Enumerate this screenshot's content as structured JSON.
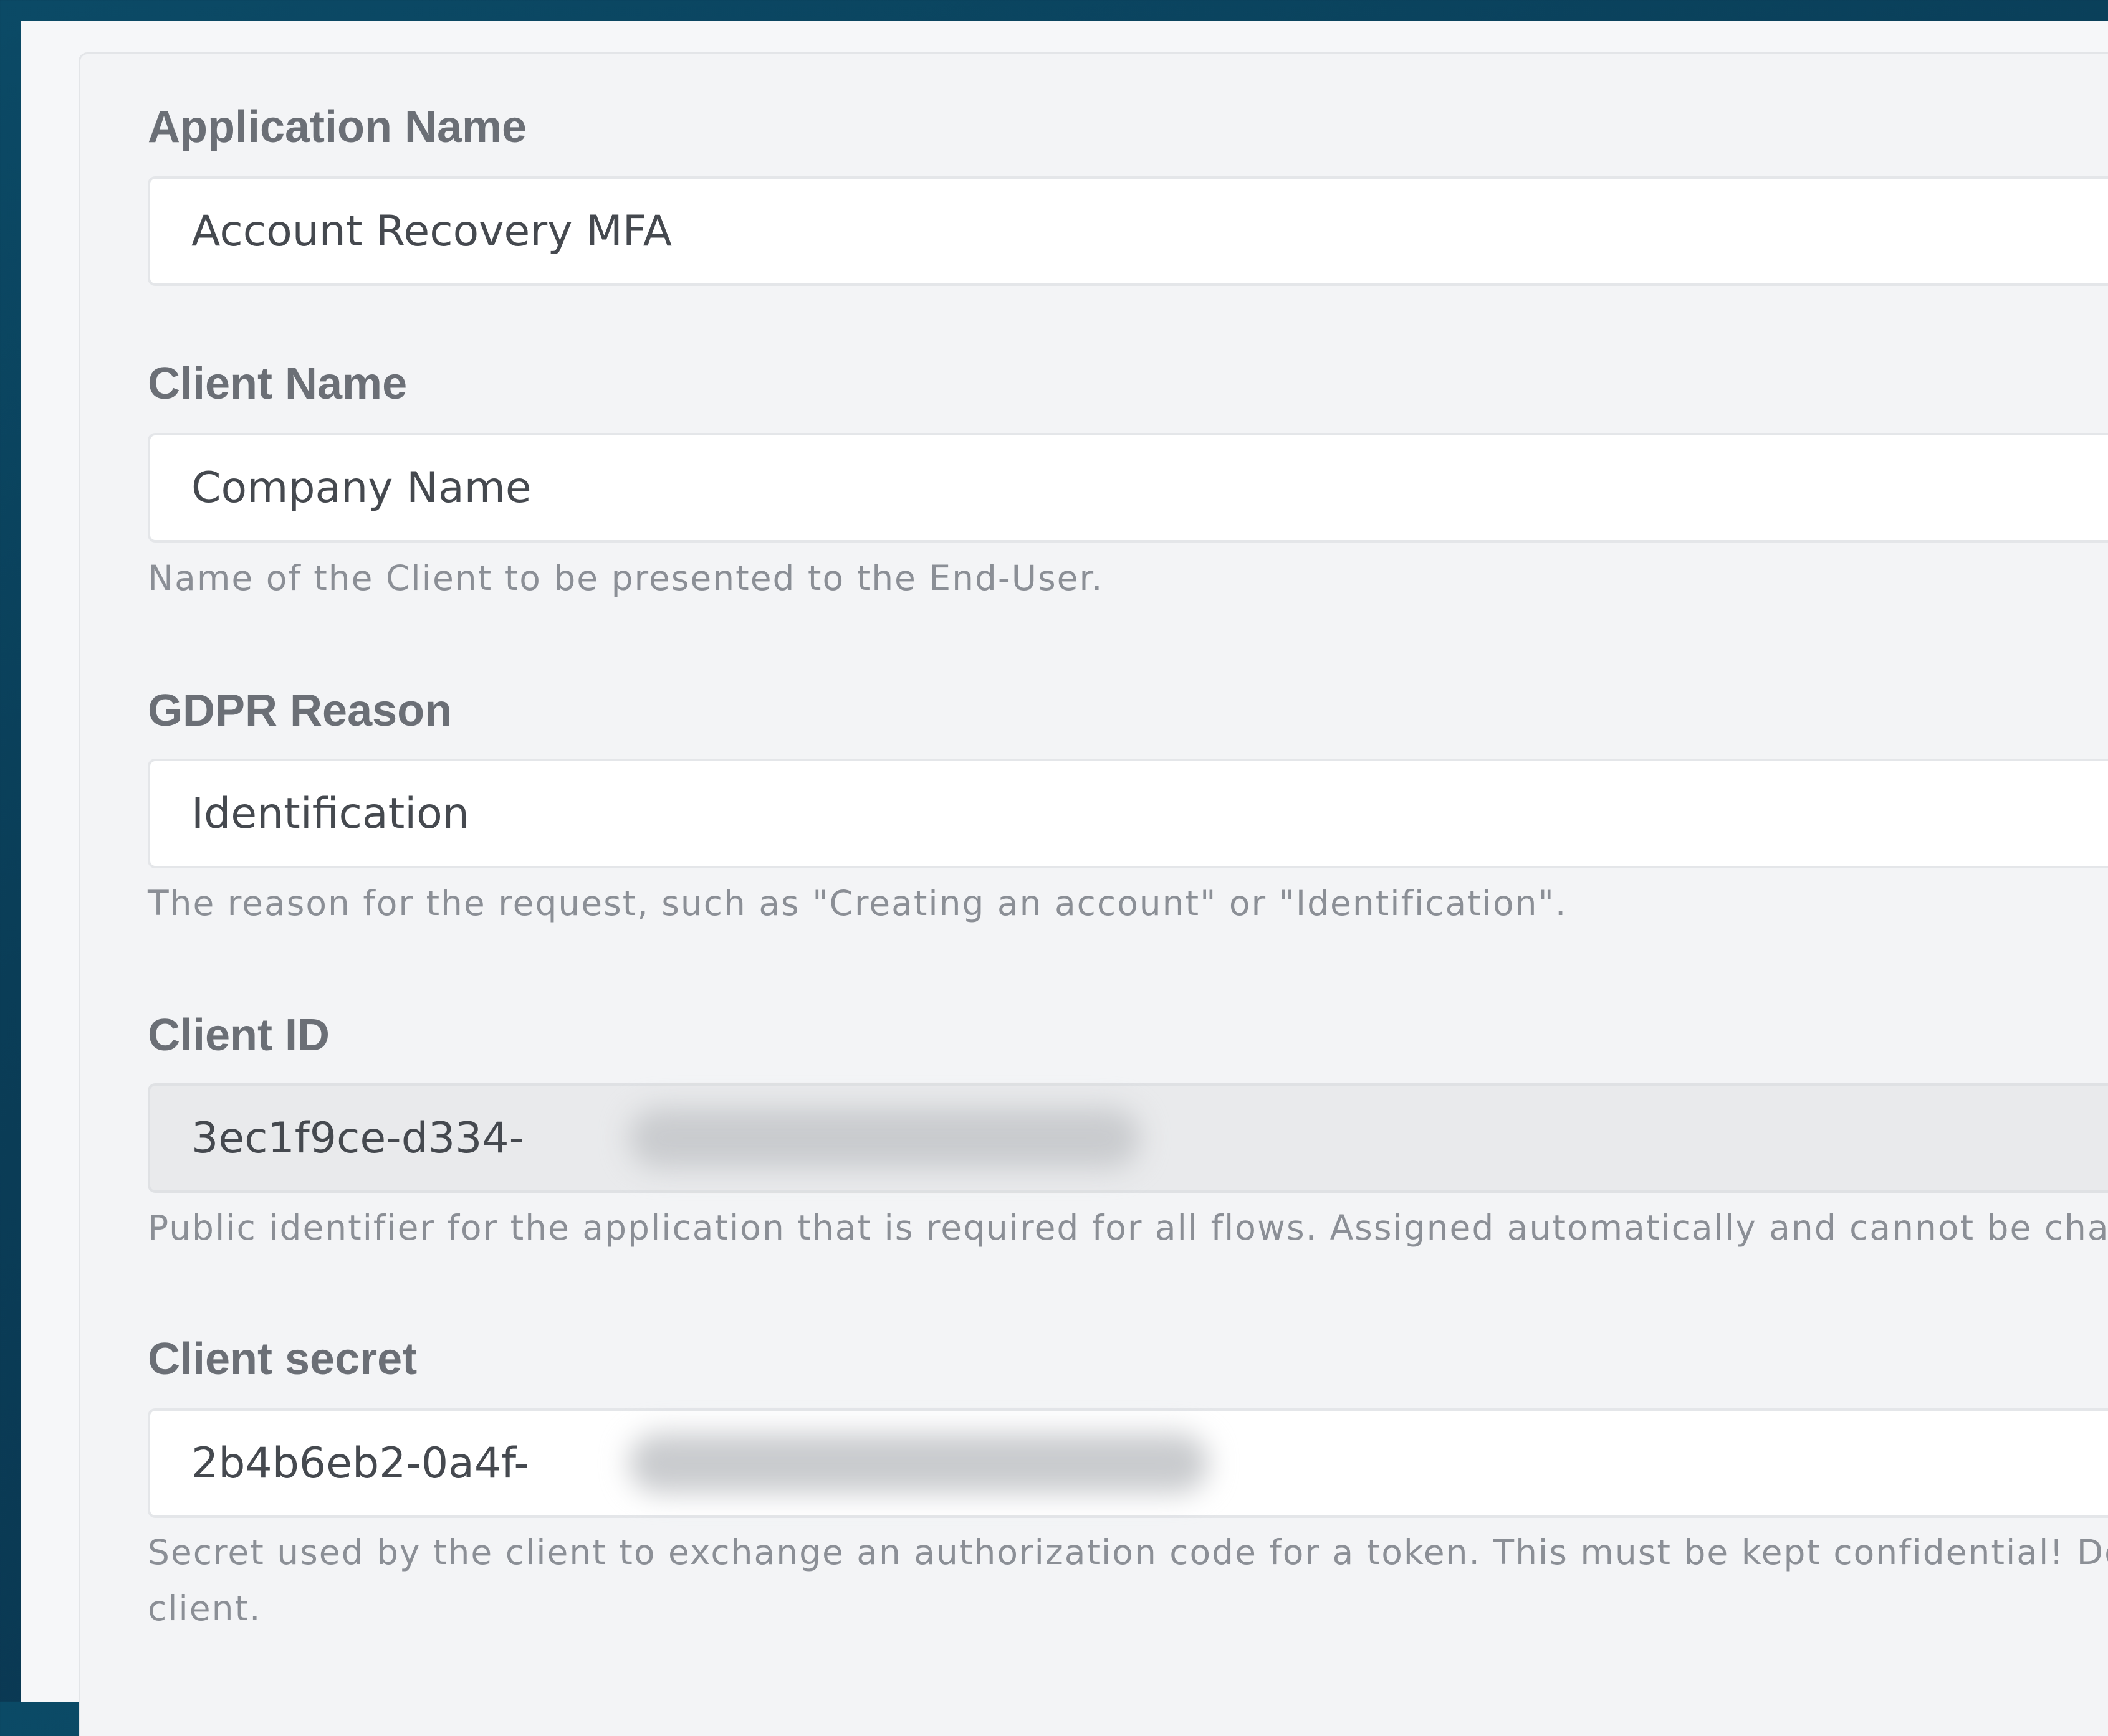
{
  "form": {
    "application_name": {
      "label": "Application Name",
      "value": "Account Recovery MFA"
    },
    "client_name": {
      "label": "Client Name",
      "value": "Company Name",
      "help": "Name of the Client to be presented to the End-User."
    },
    "gdpr_reason": {
      "label": "GDPR Reason",
      "value": "Identification",
      "help": "The reason for the request, such as \"Creating an account\" or \"Identification\"."
    },
    "client_id": {
      "label": "Client ID",
      "value": "3ec1f9ce-d334-",
      "help": "Public identifier for the application that is required for all flows. Assigned automatically and cannot be chang"
    },
    "client_secret": {
      "label": "Client secret",
      "value": "2b4b6eb2-0a4f-",
      "help_line1": "Secret used by the client to exchange an authorization code for a token. This must be kept confidential! Do n",
      "help_line2": "client."
    }
  }
}
